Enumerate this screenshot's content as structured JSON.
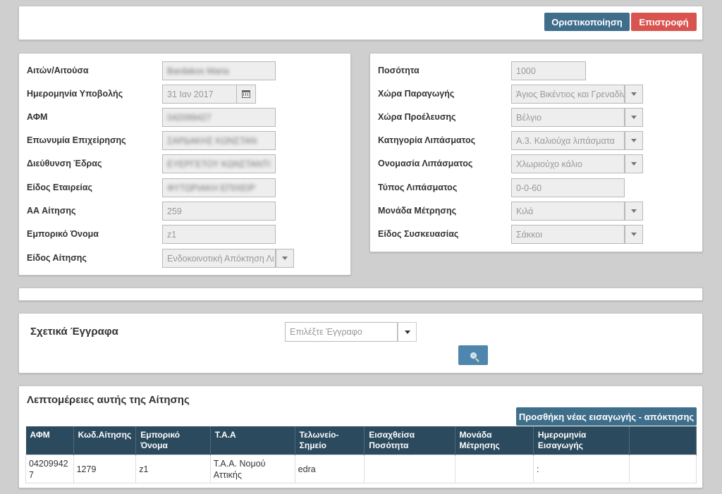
{
  "toolbar": {
    "finalize_label": "Οριστικοποίηση",
    "back_label": "Επιστροφή"
  },
  "left_form": {
    "applicant_label": "Αιτών/Αιτούσα",
    "applicant_value": "Bardakos Maria",
    "submission_date_label": "Ημερομηνία Υποβολής",
    "submission_date_value": "31 Ιαν 2017",
    "afm_label": "ΑΦΜ",
    "afm_value": "042099427",
    "company_name_label": "Επωνυμία Επιχείρησης",
    "company_name_value": "ΣΑΡΔΑΚΗΣ ΚΩΝΣΤΑΝ",
    "address_label": "Διεύθυνση Έδρας",
    "address_value": "ΕΥΕΡΓΕΤΟΥ ΚΩΝΣΤΑΝΤΙ",
    "company_type_label": "Είδος Εταιρείας",
    "company_type_value": "ΦΥΤΩΡΙΑΚΗ ΕΠΙΧΕΙΡ",
    "app_number_label": "ΑΑ Αίτησης",
    "app_number_value": "259",
    "trade_name_label": "Εμπορικό Όνομα",
    "trade_name_value": "z1",
    "app_type_label": "Είδος Αίτησης",
    "app_type_value": "Ενδοκοινοτική Απόκτηση Λι"
  },
  "right_form": {
    "quantity_label": "Ποσότητα",
    "quantity_value": "1000",
    "production_country_label": "Χώρα Παραγωγής",
    "production_country_value": "Άγιος Βικέντιος και Γρεναδίν",
    "origin_country_label": "Χώρα Προέλευσης",
    "origin_country_value": "Βέλγιο",
    "fertilizer_category_label": "Κατηγορία Λιπάσματος",
    "fertilizer_category_value": "Α.3. Καλιούχα λιπάσματα",
    "fertilizer_name_label": "Ονομασία Λιπάσματος",
    "fertilizer_name_value": "Χλωριούχο κάλιο",
    "fertilizer_type_label": "Τύπος Λιπάσματος",
    "fertilizer_type_value": "0-0-60",
    "unit_label": "Μονάδα Μέτρησης",
    "unit_value": "Κιλά",
    "packaging_label": "Είδος Συσκευασίας",
    "packaging_value": "Σάκκοι"
  },
  "documents": {
    "title": "Σχετικά Έγγραφα",
    "select_placeholder": "Επιλέξτε Έγγραφο"
  },
  "details": {
    "title": "Λεπτομέρειες αυτής της Αίτησης",
    "add_button_label": "Προσθήκη νέας εισαγωγής - απόκτησης",
    "columns": [
      "ΑΦΜ",
      "Κωδ.Αίτησης",
      "Εμπορικό Όνομα",
      "Τ.Α.Α",
      "Τελωνείο-Σημείο",
      "Εισαχθείσα Ποσότητα",
      "Μονάδα Μέτρησης",
      "Ημερομηνία Εισαγωγής",
      ""
    ],
    "rows": [
      [
        "042099427",
        "1279",
        "z1",
        "Τ.Α.Α. Νομού Αττικής",
        "edra",
        "",
        "",
        ":",
        ""
      ]
    ]
  },
  "colors": {
    "primary": "#3f6e8b",
    "danger": "#d9534f",
    "table_header": "#2b4a5e",
    "background": "#cfcfcf"
  }
}
